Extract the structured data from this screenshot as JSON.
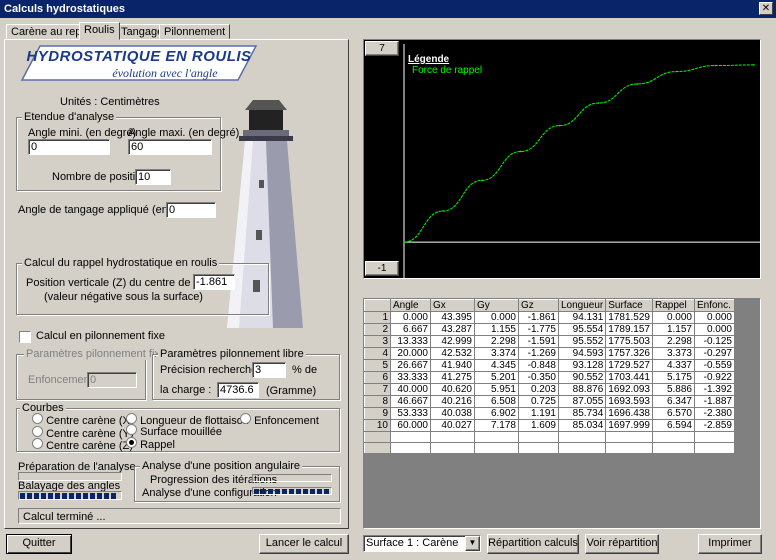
{
  "window": {
    "title": "Calculs hydrostatiques",
    "close_glyph": "✕"
  },
  "tabs": [
    {
      "label": "Carène au repos"
    },
    {
      "label": "Roulis"
    },
    {
      "label": "Tangage"
    },
    {
      "label": "Pilonnement"
    }
  ],
  "banner": {
    "title": "HYDROSTATIQUE EN ROULIS",
    "subtitle": "évolution avec l'angle"
  },
  "units": "Unités :  Centimètres",
  "analysis_range": {
    "group_label": "Etendue d'analyse",
    "min_label": "Angle mini. (en degré)",
    "min_value": "0",
    "max_label": "Angle maxi. (en degré)",
    "max_value": "60",
    "positions_label": "Nombre de positions",
    "positions_value": "10"
  },
  "pitch": {
    "label": "Angle de tangage appliqué (en degré)",
    "value": "0"
  },
  "righting": {
    "group_label": "Calcul du rappel hydrostatique en roulis",
    "line1": "Position verticale (Z) du centre de gravité :",
    "line2": "(valeur négative sous la surface)",
    "value": "-1.861"
  },
  "heave_checkbox": {
    "label": "Calcul en pilonnement fixe",
    "checked": false
  },
  "heave_fixed": {
    "group_label": "Paramètres pilonnement fixe",
    "label": "Enfoncement",
    "value": "0"
  },
  "heave_free": {
    "group_label": "Paramètres pilonnement libre",
    "precision_label": "Précision recherchée :",
    "precision_value": "3",
    "precision_unit": "% de",
    "load_label": "la charge :",
    "load_value": "4736.6",
    "load_unit": "(Gramme)"
  },
  "curves": {
    "group_label": "Courbes",
    "options": [
      {
        "label": "Centre carène (X)",
        "selected": false
      },
      {
        "label": "Centre carène (Y)",
        "selected": false
      },
      {
        "label": "Centre carène (Z)",
        "selected": false
      },
      {
        "label": "Longueur de flottaison",
        "selected": false
      },
      {
        "label": "Surface mouillée",
        "selected": false
      },
      {
        "label": "Rappel",
        "selected": true
      },
      {
        "label": "Enfoncement",
        "selected": false
      }
    ]
  },
  "progress": {
    "prep_label": "Préparation de l'analyse",
    "sweep_label": "Balayage des angles",
    "sweep_fraction": 1.0,
    "angular_group_label": "Analyse d'une position angulaire",
    "iter_label": "Progression des itérations",
    "iter_fraction": 0.0,
    "config_label": "Analyse d'une configuration",
    "config_fraction": 1.0
  },
  "status": "Calcul terminé ...",
  "buttons": {
    "quit": "Quitter",
    "run": "Lancer le calcul",
    "distribution": "Répartition calculs",
    "view_distribution": "Voir répartition",
    "print": "Imprimer"
  },
  "surface_select": {
    "value": "Surface 1 : Carène"
  },
  "chart_buttons": {
    "top": "7",
    "bottom": "-1"
  },
  "chart_data": {
    "type": "line",
    "legend_title": "Légende",
    "series": [
      {
        "name": "Force de rappel",
        "color": "#00ff00",
        "x": [
          0,
          6.667,
          13.333,
          20.0,
          26.667,
          33.333,
          40.0,
          46.667,
          53.333,
          60.0
        ],
        "values": [
          0.0,
          1.157,
          2.298,
          3.373,
          4.337,
          5.175,
          5.886,
          6.347,
          6.57,
          6.594
        ]
      }
    ],
    "ylim": [
      -1,
      7
    ],
    "xlim": [
      0,
      60
    ],
    "grid": false,
    "legend_position": "top-left",
    "background": "#000000",
    "axis_color": "#ffffff"
  },
  "table": {
    "columns": [
      "Angle",
      "Gx",
      "Gy",
      "Gz",
      "Longueur",
      "Surface",
      "Rappel",
      "Enfonc."
    ],
    "rows": [
      [
        "1",
        "0.000",
        "43.395",
        "0.000",
        "-1.861",
        "94.131",
        "1781.529",
        "0.000",
        "0.000"
      ],
      [
        "2",
        "6.667",
        "43.287",
        "1.155",
        "-1.775",
        "95.554",
        "1789.157",
        "1.157",
        "0.000"
      ],
      [
        "3",
        "13.333",
        "42.999",
        "2.298",
        "-1.591",
        "95.552",
        "1775.503",
        "2.298",
        "-0.125"
      ],
      [
        "4",
        "20.000",
        "42.532",
        "3.374",
        "-1.269",
        "94.593",
        "1757.326",
        "3.373",
        "-0.297"
      ],
      [
        "5",
        "26.667",
        "41.940",
        "4.345",
        "-0.848",
        "93.128",
        "1729.527",
        "4.337",
        "-0.559"
      ],
      [
        "6",
        "33.333",
        "41.275",
        "5.201",
        "-0.350",
        "90.552",
        "1703.441",
        "5.175",
        "-0.922"
      ],
      [
        "7",
        "40.000",
        "40.620",
        "5.951",
        "0.203",
        "88.876",
        "1692.093",
        "5.886",
        "-1.392"
      ],
      [
        "8",
        "46.667",
        "40.216",
        "6.508",
        "0.725",
        "87.055",
        "1693.593",
        "6.347",
        "-1.887"
      ],
      [
        "9",
        "53.333",
        "40.038",
        "6.902",
        "1.191",
        "85.734",
        "1696.438",
        "6.570",
        "-2.380"
      ],
      [
        "10",
        "60.000",
        "40.027",
        "7.178",
        "1.609",
        "85.034",
        "1697.999",
        "6.594",
        "-2.859"
      ]
    ]
  }
}
